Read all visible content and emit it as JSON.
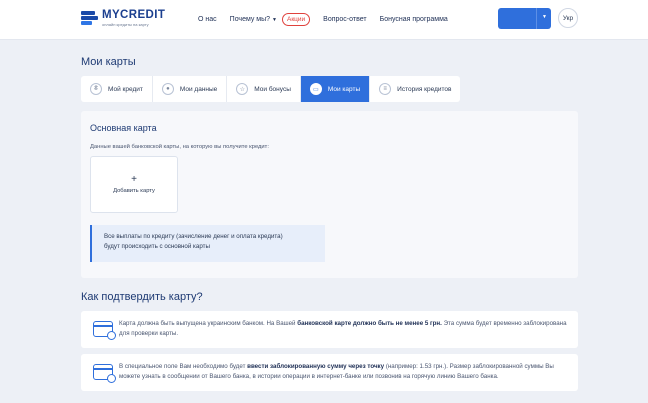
{
  "header": {
    "logo_name": "MYCREDIT",
    "logo_tagline": "онлайн кредиты на карту",
    "nav": {
      "about": "О нас",
      "why": "Почему мы?",
      "promo": "Акции",
      "faq": "Вопрос-ответ",
      "bonus": "Бонусная программа"
    },
    "language": "Укр"
  },
  "page": {
    "title": "Мои карты"
  },
  "tabs": [
    {
      "label": "Мой кредит",
      "icon": "wallet-icon"
    },
    {
      "label": "Мои данные",
      "icon": "user-icon"
    },
    {
      "label": "Мои бонусы",
      "icon": "star-icon"
    },
    {
      "label": "Мои карты",
      "icon": "card-icon",
      "active": true
    },
    {
      "label": "История кредитов",
      "icon": "list-icon"
    }
  ],
  "main_card": {
    "title": "Основная карта",
    "subtitle": "Данные вашей банковской карты, на которую вы получите кредит:",
    "add_label": "Добавить карту",
    "note_line1": "Все выплаты по кредиту (зачисление денег и оплата кредита)",
    "note_line2": "будут происходить с основной карты"
  },
  "verify": {
    "title": "Как подтвердить карту?",
    "item1": {
      "text_a": "Карта должна быть выпущена украинским банком. На Вашей ",
      "bold": "банковской карте должно быть не менее 5 грн.",
      "text_b": " Эта сумма будет временно заблокирована для проверки карты."
    },
    "item2": {
      "text_a": "В специальное поле Вам необходимо будет ",
      "bold": "ввести заблокированную сумму через точку",
      "text_b": " (например: 1.53 грн.). Размер заблокированной суммы Вы можете узнать в сообщении от Вашего банка, в истории операции в интернет-банке или позвонив на горячую линию Вашего банка."
    }
  },
  "colors": {
    "primary": "#2f6fdc",
    "brand_dark": "#1b3f8f",
    "promo": "#e0413c",
    "background": "#edf0f6"
  }
}
